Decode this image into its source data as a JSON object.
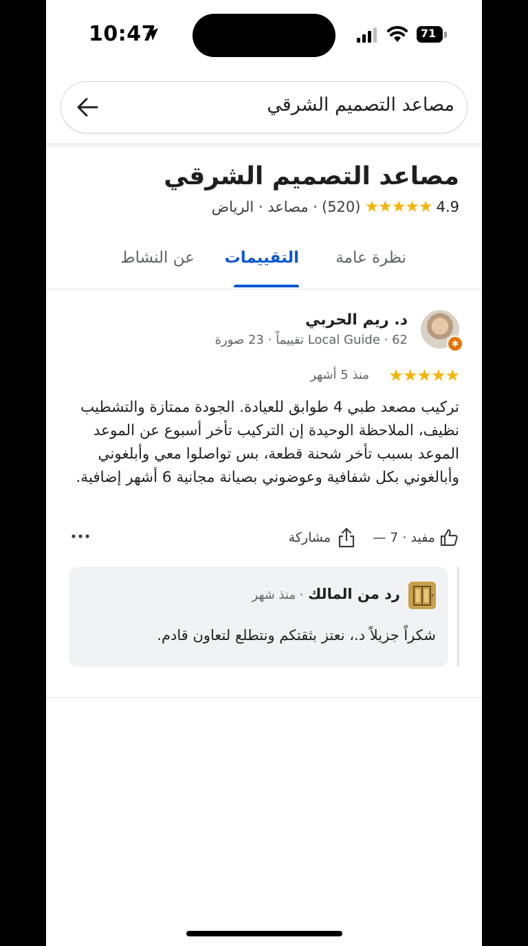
{
  "status_bar": {
    "time": "10:47",
    "battery": "71"
  },
  "search": {
    "query": "مصاعد التصميم الشرقي"
  },
  "place": {
    "title": "مصاعد التصميم الشرقي",
    "rating": "4.9",
    "stars": "★★★★★",
    "review_count": "(520)",
    "category_location": "· مصاعد · الرياض"
  },
  "tabs": [
    {
      "label": "نظرة عامة",
      "active": false
    },
    {
      "label": "التقييمات",
      "active": true
    },
    {
      "label": "عن النشاط",
      "active": false
    }
  ],
  "review": {
    "reviewer_name": "د. ريم الحربي",
    "reviewer_meta": "Local Guide · 62 تقييماً · 23 صورة",
    "stars": "★★★★★",
    "date": "منذ 5 أشهر",
    "text": "تركيب مصعد طبي 4 طوابق للعيادة. الجودة ممتازة والتشطيب نظيف، الملاحظة الوحيدة إن التركيب تأخر أسبوع عن الموعد الموعد بسبب تأخر شحنة قطعة، بس تواصلوا معي وأبلغوني وأبالغوني بكل شفافية وعوضوني بصيانة مجانية 6 أشهر إضافية.",
    "helpful": "مفيد · 7 —",
    "share": "مشاركة"
  },
  "owner_reply": {
    "label": "رد من المالك",
    "time": "· منذ شهر",
    "text": "شكراً جزيلاً د.، نعتز بثقتكم ونتطلع لتعاون قادم."
  },
  "colors": {
    "accent": "#0b57d0",
    "star": "#f5b400",
    "badge": "#e37400"
  }
}
